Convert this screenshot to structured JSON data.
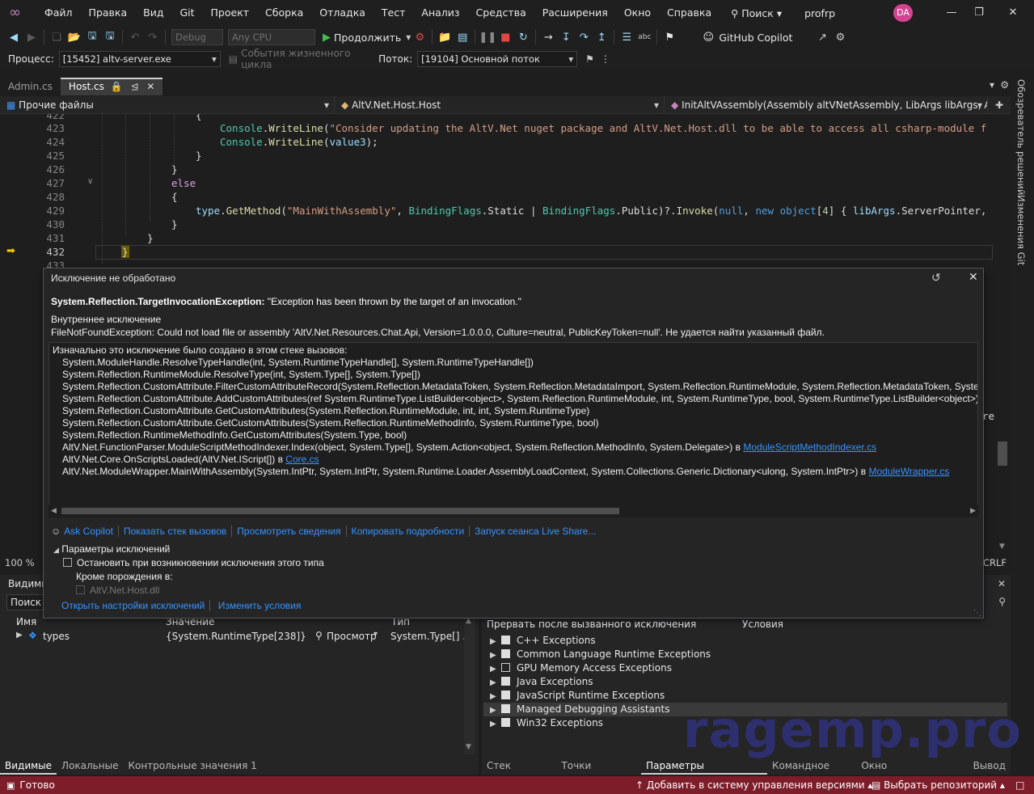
{
  "menu": {
    "items": [
      "Файл",
      "Правка",
      "Вид",
      "Git",
      "Проект",
      "Сборка",
      "Отладка",
      "Тест",
      "Анализ",
      "Средства",
      "Расширения",
      "Окно",
      "Справка"
    ],
    "search": "Поиск",
    "project": "profrp",
    "user_initials": "DA"
  },
  "toolbar": {
    "config": "Debug",
    "platform": "Any CPU",
    "continue": "Продолжить",
    "copilot": "GitHub Copilot"
  },
  "process_bar": {
    "process_label": "Процесс:",
    "process_value": "[15452] altv-server.exe",
    "lifecycle": "События жизненного цикла",
    "thread_label": "Поток:",
    "thread_value": "[19104] Основной поток"
  },
  "tabs": [
    {
      "label": "Admin.cs"
    },
    {
      "label": "Host.cs"
    }
  ],
  "nav": {
    "project": "Прочие файлы",
    "class": "AltV.Net.Host.Host",
    "member": "InitAltVAssembly(Assembly altVNetAssembly, LibArgs libArgs, Assemb"
  },
  "right_sidebar": {
    "solution_explorer": "Обозреватель решений",
    "git_changes": "Изменения Git"
  },
  "editor": {
    "lines": [
      {
        "n": "422",
        "code": "{"
      },
      {
        "n": "423",
        "code": "Console.WriteLine(\"Consider updating the AltV.Net nuget package and AltV.Net.Host.dll to be able to access all csharp-module f"
      },
      {
        "n": "424",
        "code": "Console.WriteLine(value3);"
      },
      {
        "n": "425",
        "code": "}"
      },
      {
        "n": "426",
        "code": "}"
      },
      {
        "n": "427",
        "code": "else"
      },
      {
        "n": "428",
        "code": "{"
      },
      {
        "n": "429",
        "code": "type.GetMethod(\"MainWithAssembly\", BindingFlags.Static | BindingFlags.Public)?.Invoke(null, new object[4] { libArgs.ServerPointer,"
      },
      {
        "n": "430",
        "code": "}"
      },
      {
        "n": "431",
        "code": "}"
      },
      {
        "n": "432",
        "code": "}"
      },
      {
        "n": "433",
        "code": ""
      }
    ],
    "zoom": "100 %",
    "line_ending": "CRLF",
    "partial_right": "re"
  },
  "exception": {
    "title": "Исключение не обработано",
    "type": "System.Reflection.TargetInvocationException:",
    "message": "\"Exception has been thrown by the target of an invocation.\"",
    "inner_header": "Внутреннее исключение",
    "inner_message": "FileNotFoundException: Could not load file or assembly 'AltV.Net.Resources.Chat.Api, Version=1.0.0.0, Culture=neutral, PublicKeyToken=null'. Не удается найти указанный файл.",
    "stack_header": "Изначально это исключение было создано в этом стеке вызовов:",
    "stack": [
      {
        "text": "System.ModuleHandle.ResolveTypeHandle(int, System.RuntimeTypeHandle[], System.RuntimeTypeHandle[])",
        "link": ""
      },
      {
        "text": "System.Reflection.RuntimeModule.ResolveType(int, System.Type[], System.Type[])",
        "link": ""
      },
      {
        "text": "System.Reflection.CustomAttribute.FilterCustomAttributeRecord(System.Reflection.MetadataToken, System.Reflection.MetadataImport, System.Reflection.RuntimeModule, System.Reflection.MetadataToken, System.",
        "link": ""
      },
      {
        "text": "System.Reflection.CustomAttribute.AddCustomAttributes(ref System.RuntimeType.ListBuilder<object>, System.Reflection.RuntimeModule, int, System.RuntimeType, bool, System.RuntimeType.ListBuilder<object>)",
        "link": ""
      },
      {
        "text": "System.Reflection.CustomAttribute.GetCustomAttributes(System.Reflection.RuntimeModule, int, int, System.RuntimeType)",
        "link": ""
      },
      {
        "text": "System.Reflection.CustomAttribute.GetCustomAttributes(System.Reflection.RuntimeMethodInfo, System.RuntimeType, bool)",
        "link": ""
      },
      {
        "text": "System.Reflection.RuntimeMethodInfo.GetCustomAttributes(System.Type, bool)",
        "link": ""
      },
      {
        "text": "AltV.Net.FunctionParser.ModuleScriptMethodIndexer.Index(object, System.Type[], System.Action<object, System.Reflection.MethodInfo, System.Delegate>) в ",
        "link": "ModuleScriptMethodIndexer.cs"
      },
      {
        "text": "AltV.Net.Core.OnScriptsLoaded(AltV.Net.IScript[]) в ",
        "link": "Core.cs"
      },
      {
        "text": "AltV.Net.ModuleWrapper.MainWithAssembly(System.IntPtr, System.IntPtr, System.Runtime.Loader.AssemblyLoadContext, System.Collections.Generic.Dictionary<ulong, System.IntPtr>) в ",
        "link": "ModuleWrapper.cs"
      }
    ],
    "actions": [
      "Ask Copilot",
      "Показать стек вызовов",
      "Просмотреть сведения",
      "Копировать подробности",
      "Запуск сеанса Live Share..."
    ],
    "settings_header": "Параметры исключений",
    "break_label": "Остановить при возникновении исключения этого типа",
    "except_label": "Кроме порождения в:",
    "except_item": "AltV.Net.Host.dll",
    "open_settings": "Открыть настройки исключений",
    "change_conditions": "Изменить условия"
  },
  "autos": {
    "title": "Видимь",
    "search": "Поиск",
    "col_name": "Имя",
    "col_value": "Значение",
    "col_type": "Тип",
    "rows": [
      {
        "name": "types",
        "value": "{System.RuntimeType[238]}",
        "view": "Просмотр",
        "type": "System.Type[] ..."
      }
    ],
    "tabs": [
      "Видимые",
      "Локальные",
      "Контрольные значения 1"
    ]
  },
  "exception_settings": {
    "col_break": "Прервать после вызванного исключения",
    "col_cond": "Условия",
    "items": [
      {
        "label": "C++ Exceptions",
        "checked": true
      },
      {
        "label": "Common Language Runtime Exceptions",
        "checked": true
      },
      {
        "label": "GPU Memory Access Exceptions",
        "checked": false
      },
      {
        "label": "Java Exceptions",
        "checked": true
      },
      {
        "label": "JavaScript Runtime Exceptions",
        "checked": true
      },
      {
        "label": "Managed Debugging Assistants",
        "checked": true
      },
      {
        "label": "Win32 Exceptions",
        "checked": true
      }
    ],
    "tabs": [
      "Стек вызовов",
      "Точки останова",
      "Параметры исключений",
      "Командное окно",
      "Окно интерпретации",
      "Вывод"
    ]
  },
  "status": {
    "ready": "Готово",
    "add_vcs": "Добавить в систему управления версиями",
    "select_repo": "Выбрать репозиторий"
  },
  "watermark": "ragemp.pro"
}
